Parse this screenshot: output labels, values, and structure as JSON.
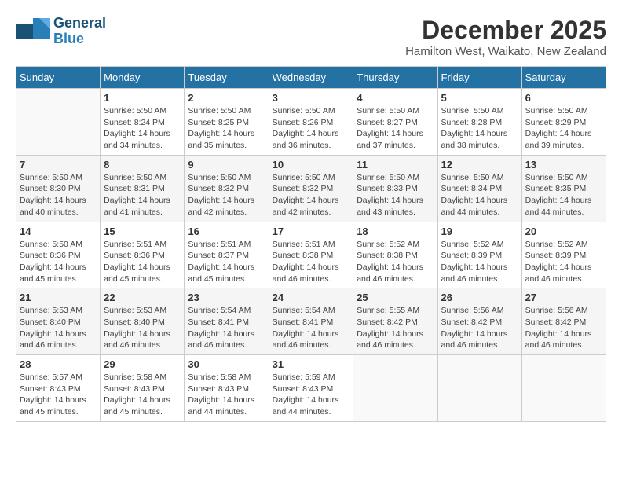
{
  "header": {
    "logo_general": "General",
    "logo_blue": "Blue",
    "month_year": "December 2025",
    "location": "Hamilton West, Waikato, New Zealand"
  },
  "days_of_week": [
    "Sunday",
    "Monday",
    "Tuesday",
    "Wednesday",
    "Thursday",
    "Friday",
    "Saturday"
  ],
  "weeks": [
    [
      {
        "day": "",
        "info": ""
      },
      {
        "day": "1",
        "info": "Sunrise: 5:50 AM\nSunset: 8:24 PM\nDaylight: 14 hours\nand 34 minutes."
      },
      {
        "day": "2",
        "info": "Sunrise: 5:50 AM\nSunset: 8:25 PM\nDaylight: 14 hours\nand 35 minutes."
      },
      {
        "day": "3",
        "info": "Sunrise: 5:50 AM\nSunset: 8:26 PM\nDaylight: 14 hours\nand 36 minutes."
      },
      {
        "day": "4",
        "info": "Sunrise: 5:50 AM\nSunset: 8:27 PM\nDaylight: 14 hours\nand 37 minutes."
      },
      {
        "day": "5",
        "info": "Sunrise: 5:50 AM\nSunset: 8:28 PM\nDaylight: 14 hours\nand 38 minutes."
      },
      {
        "day": "6",
        "info": "Sunrise: 5:50 AM\nSunset: 8:29 PM\nDaylight: 14 hours\nand 39 minutes."
      }
    ],
    [
      {
        "day": "7",
        "info": "Sunrise: 5:50 AM\nSunset: 8:30 PM\nDaylight: 14 hours\nand 40 minutes."
      },
      {
        "day": "8",
        "info": "Sunrise: 5:50 AM\nSunset: 8:31 PM\nDaylight: 14 hours\nand 41 minutes."
      },
      {
        "day": "9",
        "info": "Sunrise: 5:50 AM\nSunset: 8:32 PM\nDaylight: 14 hours\nand 42 minutes."
      },
      {
        "day": "10",
        "info": "Sunrise: 5:50 AM\nSunset: 8:32 PM\nDaylight: 14 hours\nand 42 minutes."
      },
      {
        "day": "11",
        "info": "Sunrise: 5:50 AM\nSunset: 8:33 PM\nDaylight: 14 hours\nand 43 minutes."
      },
      {
        "day": "12",
        "info": "Sunrise: 5:50 AM\nSunset: 8:34 PM\nDaylight: 14 hours\nand 44 minutes."
      },
      {
        "day": "13",
        "info": "Sunrise: 5:50 AM\nSunset: 8:35 PM\nDaylight: 14 hours\nand 44 minutes."
      }
    ],
    [
      {
        "day": "14",
        "info": "Sunrise: 5:50 AM\nSunset: 8:36 PM\nDaylight: 14 hours\nand 45 minutes."
      },
      {
        "day": "15",
        "info": "Sunrise: 5:51 AM\nSunset: 8:36 PM\nDaylight: 14 hours\nand 45 minutes."
      },
      {
        "day": "16",
        "info": "Sunrise: 5:51 AM\nSunset: 8:37 PM\nDaylight: 14 hours\nand 45 minutes."
      },
      {
        "day": "17",
        "info": "Sunrise: 5:51 AM\nSunset: 8:38 PM\nDaylight: 14 hours\nand 46 minutes."
      },
      {
        "day": "18",
        "info": "Sunrise: 5:52 AM\nSunset: 8:38 PM\nDaylight: 14 hours\nand 46 minutes."
      },
      {
        "day": "19",
        "info": "Sunrise: 5:52 AM\nSunset: 8:39 PM\nDaylight: 14 hours\nand 46 minutes."
      },
      {
        "day": "20",
        "info": "Sunrise: 5:52 AM\nSunset: 8:39 PM\nDaylight: 14 hours\nand 46 minutes."
      }
    ],
    [
      {
        "day": "21",
        "info": "Sunrise: 5:53 AM\nSunset: 8:40 PM\nDaylight: 14 hours\nand 46 minutes."
      },
      {
        "day": "22",
        "info": "Sunrise: 5:53 AM\nSunset: 8:40 PM\nDaylight: 14 hours\nand 46 minutes."
      },
      {
        "day": "23",
        "info": "Sunrise: 5:54 AM\nSunset: 8:41 PM\nDaylight: 14 hours\nand 46 minutes."
      },
      {
        "day": "24",
        "info": "Sunrise: 5:54 AM\nSunset: 8:41 PM\nDaylight: 14 hours\nand 46 minutes."
      },
      {
        "day": "25",
        "info": "Sunrise: 5:55 AM\nSunset: 8:42 PM\nDaylight: 14 hours\nand 46 minutes."
      },
      {
        "day": "26",
        "info": "Sunrise: 5:56 AM\nSunset: 8:42 PM\nDaylight: 14 hours\nand 46 minutes."
      },
      {
        "day": "27",
        "info": "Sunrise: 5:56 AM\nSunset: 8:42 PM\nDaylight: 14 hours\nand 46 minutes."
      }
    ],
    [
      {
        "day": "28",
        "info": "Sunrise: 5:57 AM\nSunset: 8:43 PM\nDaylight: 14 hours\nand 45 minutes."
      },
      {
        "day": "29",
        "info": "Sunrise: 5:58 AM\nSunset: 8:43 PM\nDaylight: 14 hours\nand 45 minutes."
      },
      {
        "day": "30",
        "info": "Sunrise: 5:58 AM\nSunset: 8:43 PM\nDaylight: 14 hours\nand 44 minutes."
      },
      {
        "day": "31",
        "info": "Sunrise: 5:59 AM\nSunset: 8:43 PM\nDaylight: 14 hours\nand 44 minutes."
      },
      {
        "day": "",
        "info": ""
      },
      {
        "day": "",
        "info": ""
      },
      {
        "day": "",
        "info": ""
      }
    ]
  ]
}
